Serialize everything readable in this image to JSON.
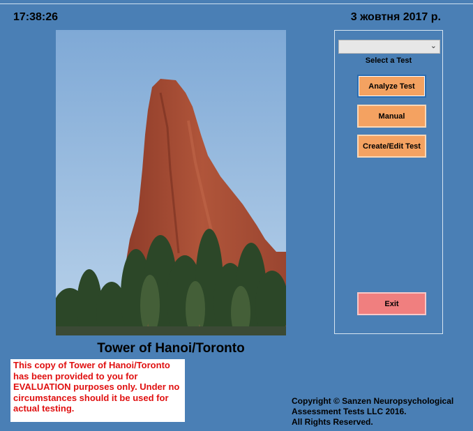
{
  "header": {
    "time": "17:38:26",
    "date": "3 жовтня 2017 р."
  },
  "photo": {
    "subject": "red sandstone rock spire with trees",
    "colors": {
      "sky": "#8fb6dd",
      "rock": "#a24a33",
      "trees": "#2f4a2c"
    }
  },
  "app": {
    "title": "Tower of Hanoi/Toronto"
  },
  "notice": {
    "text": "This copy of Tower of Hanoi/Toronto has been provided to you for EVALUATION purposes only. Under no circumstances should it be used for actual testing."
  },
  "copyright": {
    "line1": "Copyright ©  Sanzen Neuropsychological",
    "line2": "Assessment Tests LLC 2016.",
    "line3": "All Rights Reserved."
  },
  "controls": {
    "test_select": {
      "value": "",
      "label": "Select a Test"
    },
    "analyze_label": "Analyze Test",
    "manual_label": "Manual",
    "create_edit_label": "Create/Edit Test",
    "exit_label": "Exit"
  },
  "colors": {
    "background": "#4a7fb5",
    "button": "#f4a261",
    "exit_button": "#f07f7f",
    "notice_text": "#e01010"
  }
}
